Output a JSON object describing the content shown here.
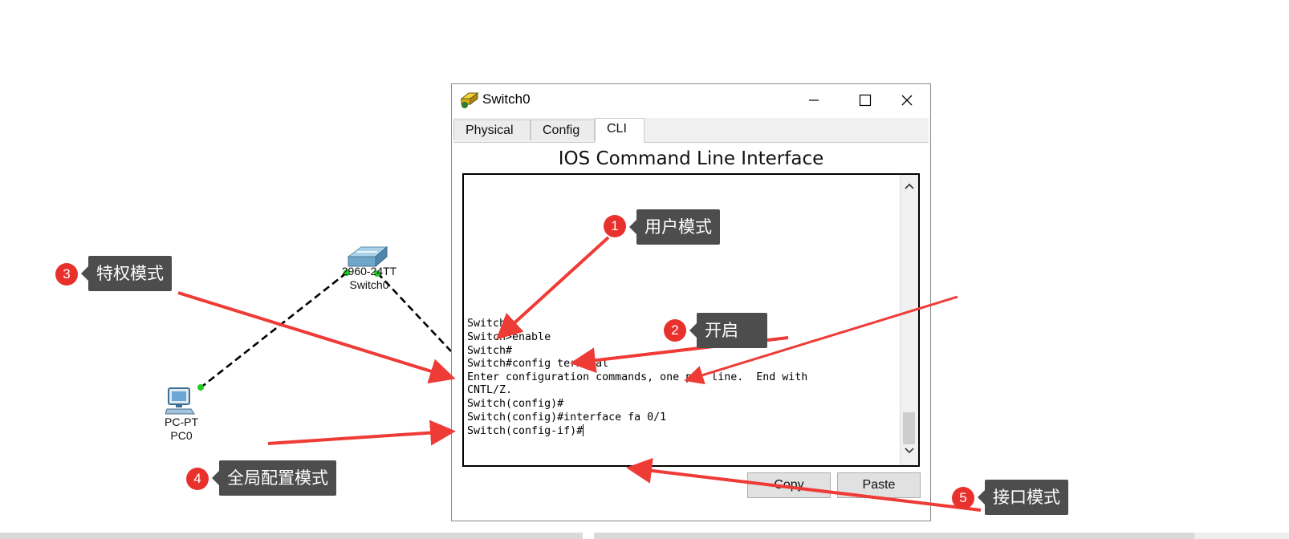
{
  "topology": {
    "switch": {
      "model": "2960-24TT",
      "name": "Switch0",
      "icon": "switch-icon"
    },
    "pc": {
      "model": "PC-PT",
      "name": "PC0",
      "icon": "pc-icon"
    }
  },
  "window": {
    "title": "Switch0",
    "icon": "switch-window-icon",
    "controls": {
      "minimize": "minimize-icon",
      "maximize": "maximize-icon",
      "close": "close-icon"
    },
    "tabs": [
      {
        "label": "Physical",
        "active": false
      },
      {
        "label": "Config",
        "active": false
      },
      {
        "label": "CLI",
        "active": true
      }
    ],
    "cli_title": "IOS Command Line Interface",
    "terminal_lines": [
      "Switch>",
      "Switch>enable",
      "Switch#",
      "Switch#config terminal",
      "Enter configuration commands, one per line.  End with",
      "CNTL/Z.",
      "Switch(config)#",
      "Switch(config)#interface fa 0/1",
      "Switch(config-if)#"
    ],
    "buttons": {
      "copy": "Copy",
      "paste": "Paste"
    }
  },
  "annotations": [
    {
      "num": "1",
      "label": "用户模式"
    },
    {
      "num": "2",
      "label": "开启"
    },
    {
      "num": "3",
      "label": "特权模式"
    },
    {
      "num": "4",
      "label": "全局配置模式"
    },
    {
      "num": "5",
      "label": "接口模式"
    }
  ],
  "colors": {
    "annotation_arrow": "#ef3b36",
    "badge": "#e8312d",
    "callout_bg": "#4d4d4d",
    "link_endpoint": "#22cc22"
  }
}
